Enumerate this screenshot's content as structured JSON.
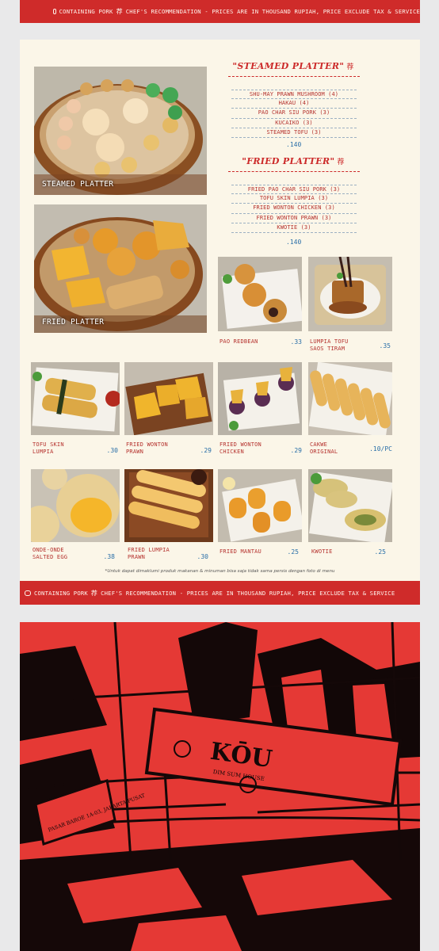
{
  "banner": {
    "pork_label": "CONTAINING PORK",
    "chef_label": "CHEF'S RECOMMENDATION - PRICES ARE IN THOUSAND RUPIAH, PRICE EXCLUDE TAX & SERVICE"
  },
  "platters": {
    "steamed": {
      "title": "\"STEAMED PLATTER\"",
      "items": [
        "SHU-MAY PRAWN MUSHROOM (4)",
        "HAKAU (4)",
        "PAO CHAR SIU PORK (3)",
        "KUCAIKO (3)",
        "STEAMED TOFU (3)"
      ],
      "price": ".140",
      "photo_caption": "STEAMED PLATTER"
    },
    "fried": {
      "title": "\"FRIED PLATTER\"",
      "items": [
        "FRIED PAO CHAR SIU PORK (3)",
        "TOFU SKIN LUMPIA (3)",
        "FRIED WONTON CHICKEN (3)",
        "FRIED WONTON PRAWN (3)",
        "KWOTIE (3)"
      ],
      "price": ".140",
      "photo_caption": "FRIED PLATTER"
    }
  },
  "dishes": [
    {
      "name": "PAO REDBEAN",
      "price": ".33"
    },
    {
      "name": "LUMPIA TOFU SAOS TIRAM",
      "price": ".35"
    },
    {
      "name": "TOFU SKIN LUMPIA",
      "price": ".30"
    },
    {
      "name": "FRIED WONTON PRAWN",
      "price": ".29"
    },
    {
      "name": "FRIED WONTON CHICKEN",
      "price": ".29"
    },
    {
      "name": "CAKWE ORIGINAL",
      "price": ".10/PC"
    },
    {
      "name": "ONDE-ONDE SALTED EGG",
      "price": ".38"
    },
    {
      "name": "FRIED LUMPIA PRAWN",
      "price": ".30"
    },
    {
      "name": "FRIED MANTAU",
      "price": ".25"
    },
    {
      "name": "KWOTIE",
      "price": ".25"
    }
  ],
  "footnote": "*Untuk dapat dimaklumi produk makanan & minuman bisa saja tidak sama persis dengan foto di menu",
  "poster": {
    "sign_brand": "KŌU",
    "sign_sub": "DIM SUM HOUSE",
    "street_sign": "PASAR BAROE 1A-03, JAKARTA PUSAT"
  },
  "colors": {
    "brand_red": "#cf2b2a",
    "price_blue": "#2a6fa8",
    "paper": "#fbf6e8"
  }
}
